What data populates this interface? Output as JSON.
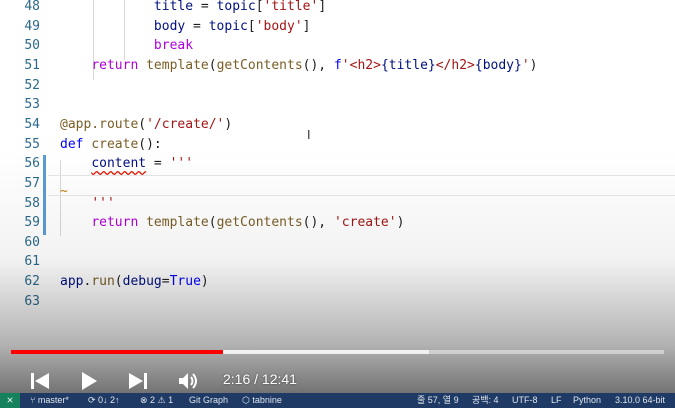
{
  "editor": {
    "lines": [
      {
        "num": "48",
        "tokens": [
          {
            "t": "            "
          },
          {
            "t": "title",
            "c": "var"
          },
          {
            "t": " = "
          },
          {
            "t": "topic",
            "c": "var"
          },
          {
            "t": "["
          },
          {
            "t": "'title'",
            "c": "str"
          },
          {
            "t": "]"
          }
        ]
      },
      {
        "num": "49",
        "tokens": [
          {
            "t": "            "
          },
          {
            "t": "body",
            "c": "var"
          },
          {
            "t": " = "
          },
          {
            "t": "topic",
            "c": "var"
          },
          {
            "t": "["
          },
          {
            "t": "'body'",
            "c": "str"
          },
          {
            "t": "]"
          }
        ]
      },
      {
        "num": "50",
        "tokens": [
          {
            "t": "            "
          },
          {
            "t": "break",
            "c": "kw"
          }
        ]
      },
      {
        "num": "51",
        "tokens": [
          {
            "t": "    "
          },
          {
            "t": "return",
            "c": "kw"
          },
          {
            "t": " "
          },
          {
            "t": "template",
            "c": "fn"
          },
          {
            "t": "("
          },
          {
            "t": "getContents",
            "c": "fn"
          },
          {
            "t": "(), "
          },
          {
            "t": "f",
            "c": "const"
          },
          {
            "t": "'<h2>",
            "c": "str"
          },
          {
            "t": "{title}",
            "c": "var"
          },
          {
            "t": "</h2>",
            "c": "str"
          },
          {
            "t": "{body}",
            "c": "var"
          },
          {
            "t": "'",
            "c": "str"
          },
          {
            "t": ")"
          }
        ]
      },
      {
        "num": "52",
        "tokens": []
      },
      {
        "num": "53",
        "tokens": []
      },
      {
        "num": "54",
        "tokens": [
          {
            "t": "@app.route",
            "c": "deco"
          },
          {
            "t": "("
          },
          {
            "t": "'/create/'",
            "c": "str"
          },
          {
            "t": ")"
          }
        ]
      },
      {
        "num": "55",
        "tokens": [
          {
            "t": "def",
            "c": "const"
          },
          {
            "t": " "
          },
          {
            "t": "create",
            "c": "fn"
          },
          {
            "t": "():"
          }
        ]
      },
      {
        "num": "56",
        "tokens": [
          {
            "t": "    "
          },
          {
            "t": "content",
            "c": "var err"
          },
          {
            "t": " = "
          },
          {
            "t": "'''",
            "c": "str"
          }
        ]
      },
      {
        "num": "57",
        "tokens": []
      },
      {
        "num": "58",
        "tokens": [
          {
            "t": "    "
          },
          {
            "t": "'''",
            "c": "str"
          }
        ]
      },
      {
        "num": "59",
        "tokens": [
          {
            "t": "    "
          },
          {
            "t": "return",
            "c": "kw"
          },
          {
            "t": " "
          },
          {
            "t": "template",
            "c": "fn"
          },
          {
            "t": "("
          },
          {
            "t": "getContents",
            "c": "fn"
          },
          {
            "t": "(), "
          },
          {
            "t": "'create'",
            "c": "str"
          },
          {
            "t": ")"
          }
        ]
      },
      {
        "num": "60",
        "tokens": []
      },
      {
        "num": "61",
        "tokens": []
      },
      {
        "num": "62",
        "tokens": [
          {
            "t": "app",
            "c": "var"
          },
          {
            "t": "."
          },
          {
            "t": "run",
            "c": "fn"
          },
          {
            "t": "("
          },
          {
            "t": "debug",
            "c": "var"
          },
          {
            "t": "="
          },
          {
            "t": "True",
            "c": "const"
          },
          {
            "t": ")"
          }
        ]
      },
      {
        "num": "63",
        "tokens": []
      }
    ],
    "tilde_glyph": "~",
    "cursor_glyph": "I"
  },
  "player": {
    "time_display": "2:16 / 12:41",
    "played_fraction": 0.325,
    "buffered_fraction": 0.64,
    "progress_color": "#ff0000",
    "buttons": {
      "prev_icon": "skip-previous-icon",
      "play_icon": "play-icon",
      "next_icon": "skip-next-icon",
      "volume_icon": "volume-icon"
    }
  },
  "statusbar": {
    "remote": "⨯",
    "branch": "master*",
    "sync": "0↓ 2↑",
    "problems": "⊗ 2 ⚠ 1",
    "git_graph": "Git Graph",
    "tabnine": "tabnine",
    "position": "줄 57, 열 9",
    "spaces": "공백: 4",
    "encoding": "UTF-8",
    "eol": "LF",
    "language": "Python",
    "interpreter": "3.10.0 64-bit",
    "bg_color": "#1f3a64"
  }
}
